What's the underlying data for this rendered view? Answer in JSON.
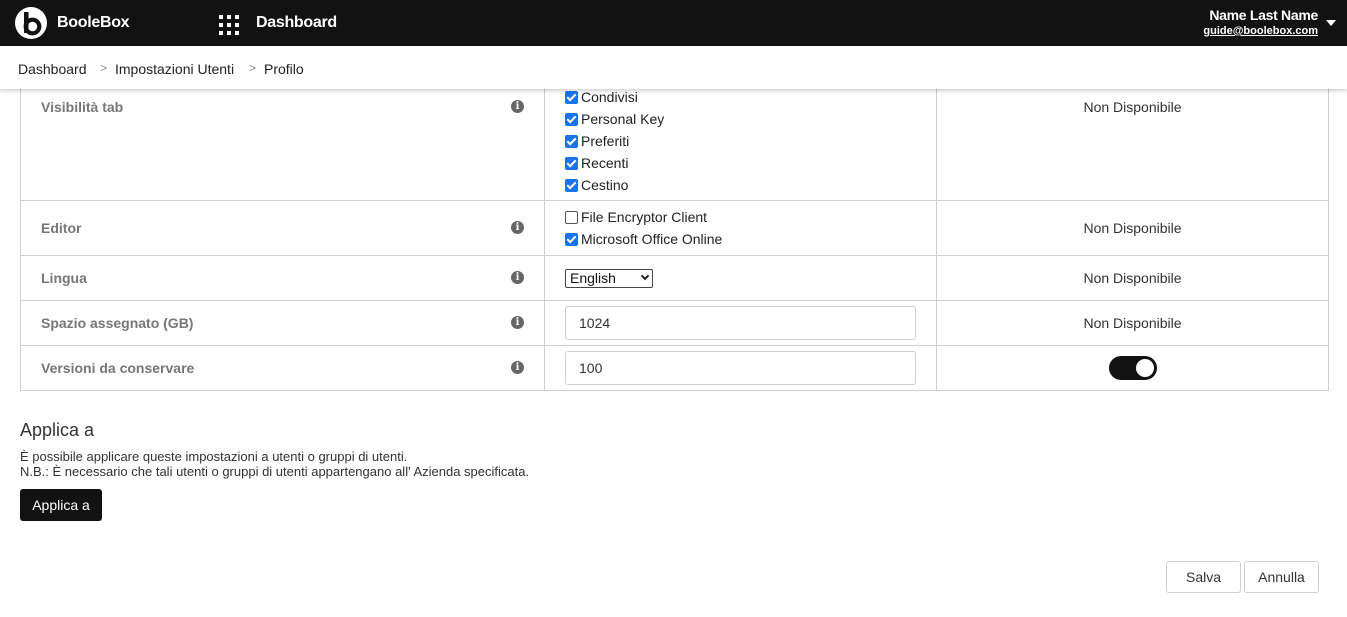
{
  "header": {
    "brand": "BooleBox",
    "title": "Dashboard",
    "user_name": "Name Last Name",
    "user_email": "guide@boolebox.com"
  },
  "breadcrumb": {
    "items": [
      "Dashboard",
      "Impostazioni Utenti",
      "Profilo"
    ],
    "separator": ">"
  },
  "settings": {
    "availability_text": "Non Disponibile",
    "info_glyph": "i",
    "rows": {
      "tab_visibility": {
        "label": "Visibilità tab",
        "options": [
          {
            "label": "Condivisi",
            "checked": true
          },
          {
            "label": "Personal Key",
            "checked": true
          },
          {
            "label": "Preferiti",
            "checked": true
          },
          {
            "label": "Recenti",
            "checked": true
          },
          {
            "label": "Cestino",
            "checked": true
          }
        ]
      },
      "editor": {
        "label": "Editor",
        "options": [
          {
            "label": "File Encryptor Client",
            "checked": false
          },
          {
            "label": "Microsoft Office Online",
            "checked": true
          }
        ]
      },
      "language": {
        "label": "Lingua",
        "selected": "English"
      },
      "storage": {
        "label": "Spazio assegnato (GB)",
        "value": "1024"
      },
      "versions": {
        "label": "Versioni da conservare",
        "value": "100",
        "toggle_on": true
      }
    }
  },
  "apply": {
    "title": "Applica a",
    "desc1": "È possibile applicare queste impostazioni a utenti o gruppi di utenti.",
    "desc2": "N.B.: È necessario che tali utenti o gruppi di utenti appartengano all' Azienda specificata.",
    "button_label": "Applica a"
  },
  "footer": {
    "save_label": "Salva",
    "cancel_label": "Annulla"
  },
  "colors": {
    "topbar": "#121212",
    "checkbox": "#1a73e8"
  }
}
